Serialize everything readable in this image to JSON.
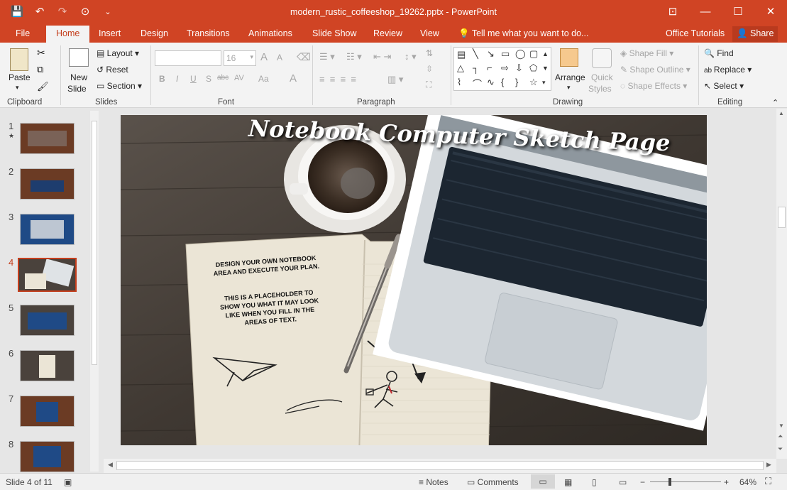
{
  "titlebar": {
    "title": "modern_rustic_coffeeshop_19262.pptx - PowerPoint",
    "qat": [
      {
        "icon": "save-icon",
        "glyph": "💾"
      },
      {
        "icon": "undo-icon",
        "glyph": "↶"
      },
      {
        "icon": "redo-icon",
        "glyph": "↷"
      },
      {
        "icon": "slideshow-icon",
        "glyph": "⊙"
      },
      {
        "icon": "customize-icon",
        "glyph": "⌄"
      }
    ],
    "window_controls": {
      "restore_ribbon": "⊡",
      "minimize": "—",
      "maximize": "☐",
      "close": "✕"
    }
  },
  "tabs": {
    "items": [
      "File",
      "Home",
      "Insert",
      "Design",
      "Transitions",
      "Animations",
      "Slide Show",
      "Review",
      "View"
    ],
    "active": "Home",
    "tell_me": "Tell me what you want to do...",
    "office_tutorials": "Office Tutorials",
    "share": "Share"
  },
  "ribbon": {
    "clipboard": {
      "label": "Clipboard",
      "paste": "Paste"
    },
    "slides": {
      "label": "Slides",
      "new_slide": "New",
      "new_slide2": "Slide",
      "layout": "Layout",
      "reset": "Reset",
      "section": "Section"
    },
    "font": {
      "label": "Font",
      "size": "16",
      "bold": "B",
      "italic": "I",
      "underline": "U",
      "shadow": "S",
      "strike": "abc",
      "spacing": "AV",
      "case": "Aa",
      "color": "A",
      "grow": "A",
      "shrink": "A"
    },
    "paragraph": {
      "label": "Paragraph"
    },
    "drawing": {
      "label": "Drawing",
      "arrange": "Arrange",
      "quick": "Quick",
      "styles": "Styles",
      "shape_fill": "Shape Fill",
      "shape_outline": "Shape Outline",
      "shape_effects": "Shape Effects"
    },
    "editing": {
      "label": "Editing",
      "find": "Find",
      "replace": "Replace",
      "select": "Select"
    }
  },
  "thumbnails": {
    "items": [
      {
        "num": "1",
        "star": "★"
      },
      {
        "num": "2"
      },
      {
        "num": "3"
      },
      {
        "num": "4"
      },
      {
        "num": "5"
      },
      {
        "num": "6"
      },
      {
        "num": "7"
      },
      {
        "num": "8"
      }
    ],
    "active": "4"
  },
  "slide": {
    "title": "Notebook Computer Sketch Page",
    "notebook_text_1": "DESIGN YOUR OWN NOTEBOOK AREA AND EXECUTE YOUR PLAN.",
    "notebook_text_2": "THIS IS A PLACEHOLDER TO SHOW YOU WHAT IT MAY LOOK LIKE WHEN YOU FILL IN THE AREAS OF TEXT."
  },
  "status": {
    "slide_of": "Slide 4 of 11",
    "notes": "Notes",
    "comments": "Comments",
    "zoom": "64%"
  },
  "colors": {
    "accent": "#d04424",
    "wood": "#4a423c",
    "paper": "#ebe5d6"
  }
}
